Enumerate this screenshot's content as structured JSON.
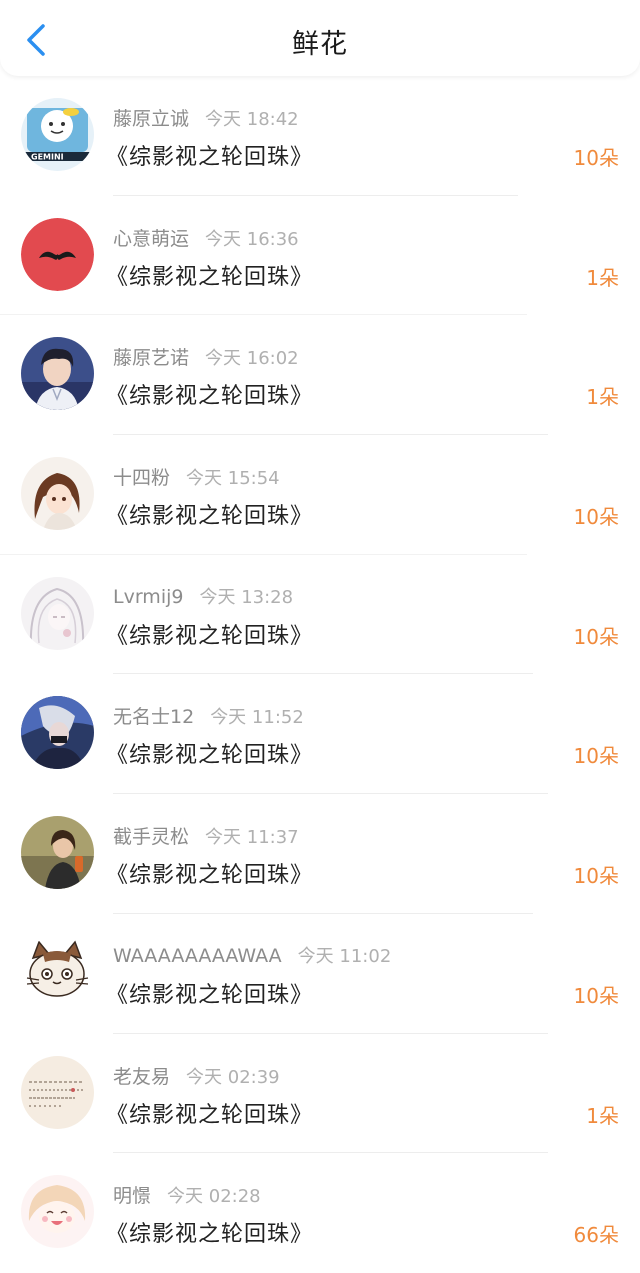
{
  "header": {
    "title": "鲜花",
    "back_icon": "chevron-left-icon",
    "accent_color": "#2b8ff0"
  },
  "colors": {
    "count": "#f08a3c",
    "username": "#8c8c8c",
    "time": "#b0b0b0"
  },
  "items": [
    {
      "name": "藤原立诚",
      "time": "今天 18:42",
      "book": "《综影视之轮回珠》",
      "count": "10朵",
      "avatar": "gemini-cartoon-avatar"
    },
    {
      "name": "心意萌运",
      "time": "今天 16:36",
      "book": "《综影视之轮回珠》",
      "count": "1朵",
      "avatar": "mustache-avatar"
    },
    {
      "name": "藤原艺诺",
      "time": "今天 16:02",
      "book": "《综影视之轮回珠》",
      "count": "1朵",
      "avatar": "boy-photo-avatar"
    },
    {
      "name": "十四粉",
      "time": "今天 15:54",
      "book": "《综影视之轮回珠》",
      "count": "10朵",
      "avatar": "anime-girl-avatar"
    },
    {
      "name": "Lvrmij9",
      "time": "今天 13:28",
      "book": "《综影视之轮回珠》",
      "count": "10朵",
      "avatar": "sketch-girl-avatar"
    },
    {
      "name": "无名士12",
      "time": "今天 11:52",
      "book": "《综影视之轮回珠》",
      "count": "10朵",
      "avatar": "anime-warrior-avatar"
    },
    {
      "name": "截手灵松",
      "time": "今天 11:37",
      "book": "《综影视之轮回珠》",
      "count": "10朵",
      "avatar": "woman-photo-avatar"
    },
    {
      "name": "WAAAAAAAAWAA",
      "time": "今天 11:02",
      "book": "《综影视之轮回珠》",
      "count": "10朵",
      "avatar": "cat-cartoon-avatar"
    },
    {
      "name": "老友易",
      "time": "今天 02:39",
      "book": "《综影视之轮回珠》",
      "count": "1朵",
      "avatar": "handwriting-avatar"
    },
    {
      "name": "明憬",
      "time": "今天 02:28",
      "book": "《综影视之轮回珠》",
      "count": "66朵",
      "avatar": "chibi-girl-avatar"
    }
  ]
}
